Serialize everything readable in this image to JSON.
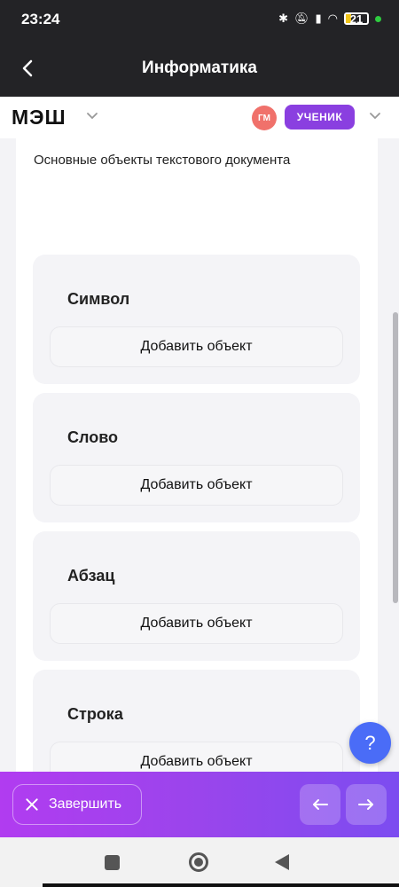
{
  "status": {
    "time": "23:24",
    "battery": "21"
  },
  "header": {
    "title": "Информатика"
  },
  "brand": {
    "logo": "МЭШ",
    "avatar_initials": "ГМ",
    "role": "УЧЕНИК"
  },
  "task": {
    "prompt": "Основные объекты текстового документа",
    "groups": [
      {
        "title": "Символ",
        "button": "Добавить объект"
      },
      {
        "title": "Слово",
        "button": "Добавить объект"
      },
      {
        "title": "Абзац",
        "button": "Добавить объект"
      },
      {
        "title": "Строка",
        "button": "Добавить объект"
      }
    ]
  },
  "help": {
    "label": "?"
  },
  "footer": {
    "finish_label": "Завершить",
    "prev_icon": "arrow-left-icon",
    "next_icon": "arrow-right-icon"
  },
  "colors": {
    "accent_purple": "#8a3fe0",
    "help_blue": "#4a6cf7",
    "avatar_red": "#f0716b"
  }
}
